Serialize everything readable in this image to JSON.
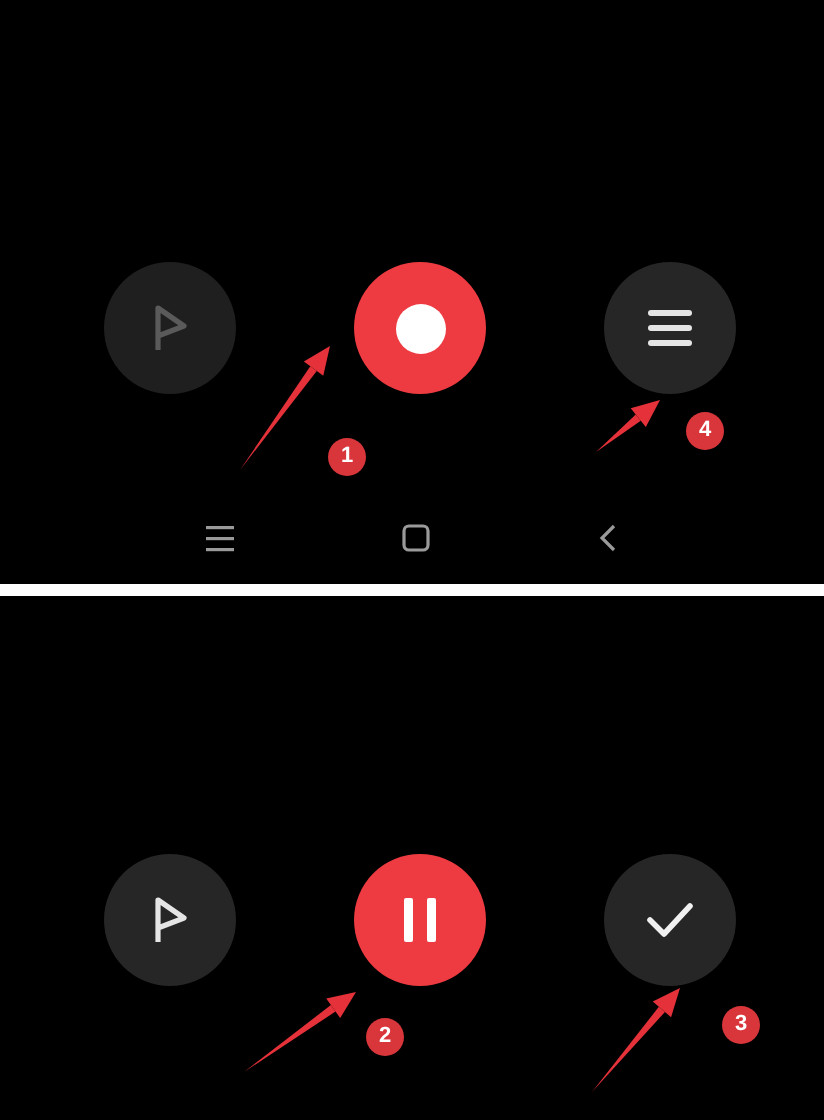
{
  "panels": [
    {
      "buttons": [
        {
          "kind": "flag",
          "disabled": true
        },
        {
          "kind": "record"
        },
        {
          "kind": "menu"
        }
      ],
      "nav_bar": [
        {
          "kind": "recents"
        },
        {
          "kind": "home"
        },
        {
          "kind": "back"
        }
      ],
      "annotations": [
        {
          "number": "1"
        },
        {
          "number": "4"
        }
      ]
    },
    {
      "buttons": [
        {
          "kind": "flag",
          "disabled": false
        },
        {
          "kind": "pause"
        },
        {
          "kind": "check"
        }
      ],
      "annotations": [
        {
          "number": "2"
        },
        {
          "number": "3"
        }
      ]
    }
  ]
}
